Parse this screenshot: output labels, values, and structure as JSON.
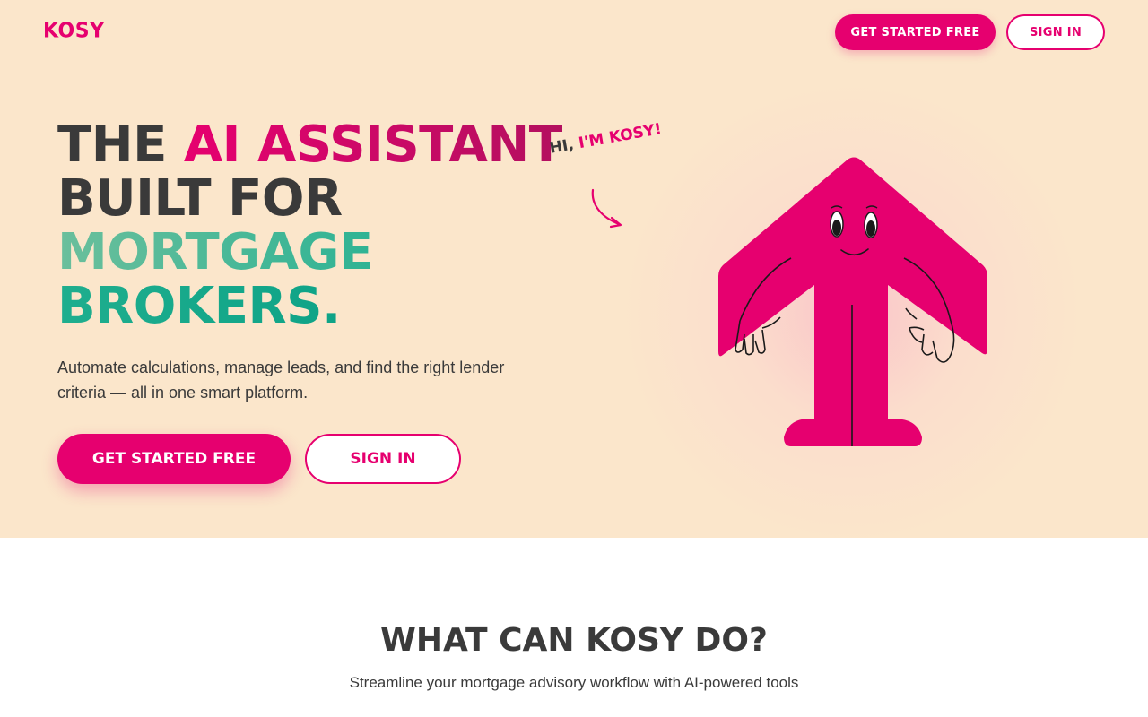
{
  "brand": {
    "logo": "KOSY",
    "colors": {
      "primary_pink": "#e6006f",
      "hero_background": "#fbe6cb",
      "teal": "#1fae8e",
      "text_dark": "#3a3a3a"
    }
  },
  "nav": {
    "get_started_label": "GET STARTED FREE",
    "sign_in_label": "SIGN IN"
  },
  "hero": {
    "headline": {
      "part1": "THE ",
      "part2": "AI ASSISTANT",
      "part3": "BUILT FOR",
      "part4": "MORTGAGE",
      "part5": "BROKERS."
    },
    "subtext": "Automate calculations, manage leads, and find the right lender criteria — all in one smart platform.",
    "cta_primary": "GET STARTED FREE",
    "cta_secondary": "SIGN IN",
    "speech_part1": "HI, ",
    "speech_part2": "I'M KOSY!",
    "mascot_icon": "house-mascot-icon",
    "arrow_icon": "curved-arrow-icon"
  },
  "features": {
    "title": "WHAT CAN KOSY DO?",
    "subtitle": "Streamline your mortgage advisory workflow with AI-powered tools"
  }
}
